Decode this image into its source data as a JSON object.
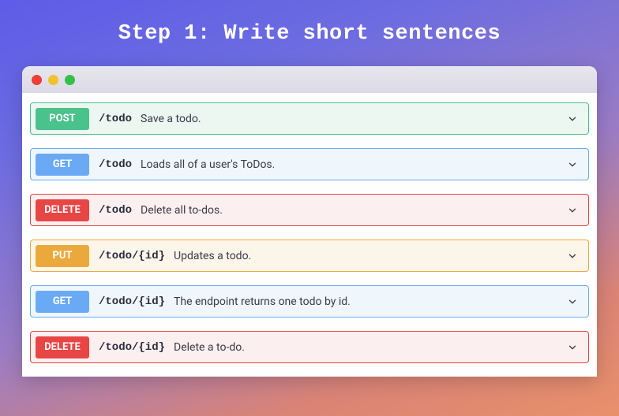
{
  "title": "Step 1: Write short sentences",
  "endpoints": [
    {
      "method": "POST",
      "variant": "post",
      "path": "/todo",
      "desc": "Save a todo."
    },
    {
      "method": "GET",
      "variant": "get",
      "path": "/todo",
      "desc": "Loads all of a user's ToDos."
    },
    {
      "method": "DELETE",
      "variant": "delete",
      "path": "/todo",
      "desc": "Delete all to-dos."
    },
    {
      "method": "PUT",
      "variant": "put",
      "path": "/todo/{id}",
      "desc": "Updates a todo."
    },
    {
      "method": "GET",
      "variant": "get",
      "path": "/todo/{id}",
      "desc": "The endpoint returns one todo by id."
    },
    {
      "method": "DELETE",
      "variant": "delete",
      "path": "/todo/{id}",
      "desc": "Delete a to-do."
    }
  ]
}
